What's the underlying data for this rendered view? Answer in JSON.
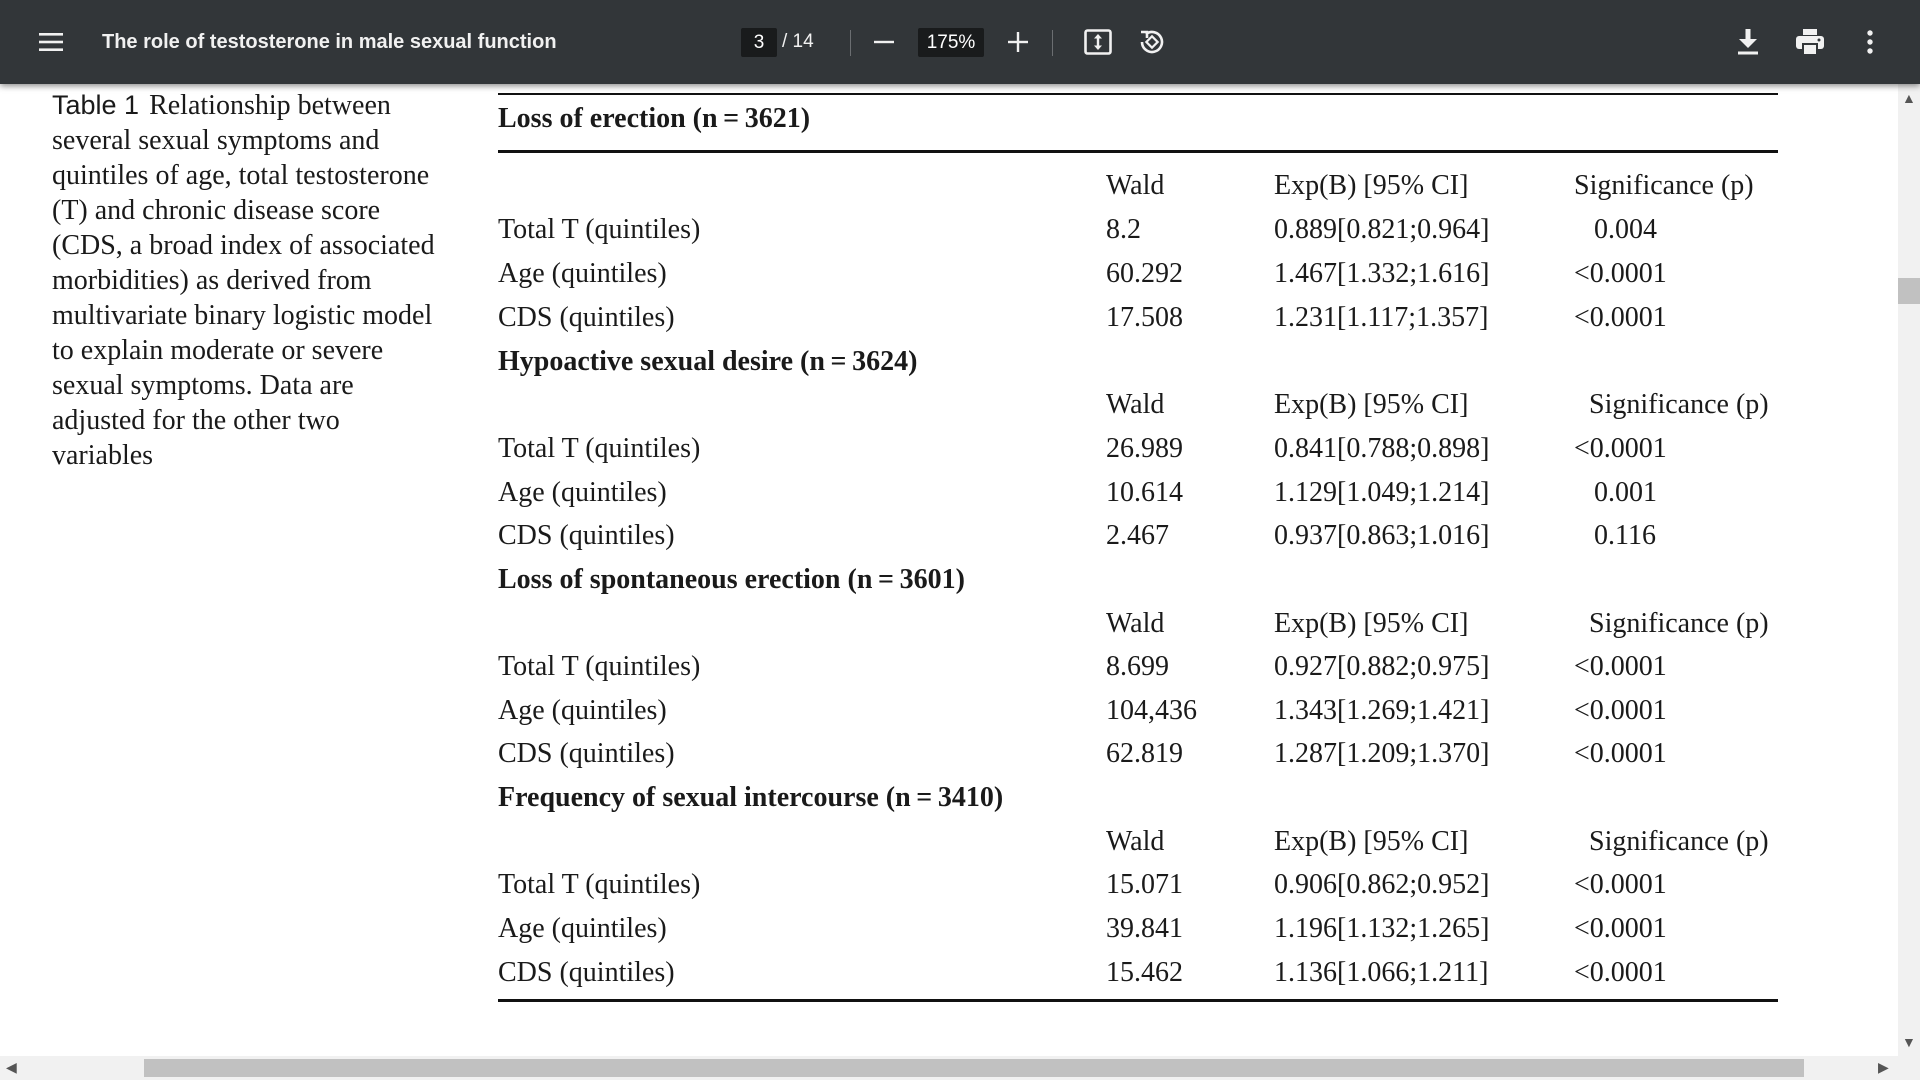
{
  "toolbar": {
    "title": "The role of testosterone in male sexual function",
    "current_page": "3",
    "total_pages": "/ 14",
    "zoom": "175%",
    "icons": {
      "menu": "menu-icon",
      "zoom_out": "minus-icon",
      "zoom_in": "plus-icon",
      "fit": "fit-to-page-icon",
      "rotate": "rotate-icon",
      "download": "download-icon",
      "print": "print-icon",
      "more": "more-vertical-icon"
    }
  },
  "caption": {
    "label": "Table 1",
    "text": "Relationship between several sexual symptoms and quintiles of age, total testosterone (T) and chronic disease score (CDS, a broad index of associated morbidities) as derived from multivariate binary logistic model to explain moderate or severe sexual symptoms. Data are adjusted for the other two variables"
  },
  "table": {
    "header": {
      "wald": "Wald",
      "exp": "Exp(B) [95% CI]",
      "sig": "Significance (p)"
    },
    "sections": [
      {
        "title": "Loss of erection (n = 3621)",
        "rows": [
          {
            "label": "Total T (quintiles)",
            "wald": "8.2",
            "exp": "0.889[0.821;0.964]",
            "sig": "0.004"
          },
          {
            "label": "Age (quintiles)",
            "wald": "60.292",
            "exp": "1.467[1.332;1.616]",
            "sig": "<0.0001"
          },
          {
            "label": "CDS (quintiles)",
            "wald": "17.508",
            "exp": "1.231[1.117;1.357]",
            "sig": "<0.0001"
          }
        ]
      },
      {
        "title": "Hypoactive sexual desire (n = 3624)",
        "rows": [
          {
            "label": "Total T (quintiles)",
            "wald": "26.989",
            "exp": "0.841[0.788;0.898]",
            "sig": "<0.0001"
          },
          {
            "label": "Age (quintiles)",
            "wald": "10.614",
            "exp": "1.129[1.049;1.214]",
            "sig": "0.001"
          },
          {
            "label": "CDS (quintiles)",
            "wald": "2.467",
            "exp": "0.937[0.863;1.016]",
            "sig": "0.116"
          }
        ]
      },
      {
        "title": "Loss of spontaneous erection (n = 3601)",
        "rows": [
          {
            "label": "Total T (quintiles)",
            "wald": "8.699",
            "exp": "0.927[0.882;0.975]",
            "sig": "<0.0001"
          },
          {
            "label": "Age (quintiles)",
            "wald": "104,436",
            "exp": "1.343[1.269;1.421]",
            "sig": "<0.0001"
          },
          {
            "label": "CDS (quintiles)",
            "wald": "62.819",
            "exp": "1.287[1.209;1.370]",
            "sig": "<0.0001"
          }
        ]
      },
      {
        "title": "Frequency of sexual intercourse (n = 3410)",
        "rows": [
          {
            "label": "Total T (quintiles)",
            "wald": "15.071",
            "exp": "0.906[0.862;0.952]",
            "sig": "<0.0001"
          },
          {
            "label": "Age (quintiles)",
            "wald": "39.841",
            "exp": "1.196[1.132;1.265]",
            "sig": "<0.0001"
          },
          {
            "label": "CDS (quintiles)",
            "wald": "15.462",
            "exp": "1.136[1.066;1.211]",
            "sig": "<0.0001"
          }
        ]
      }
    ]
  }
}
